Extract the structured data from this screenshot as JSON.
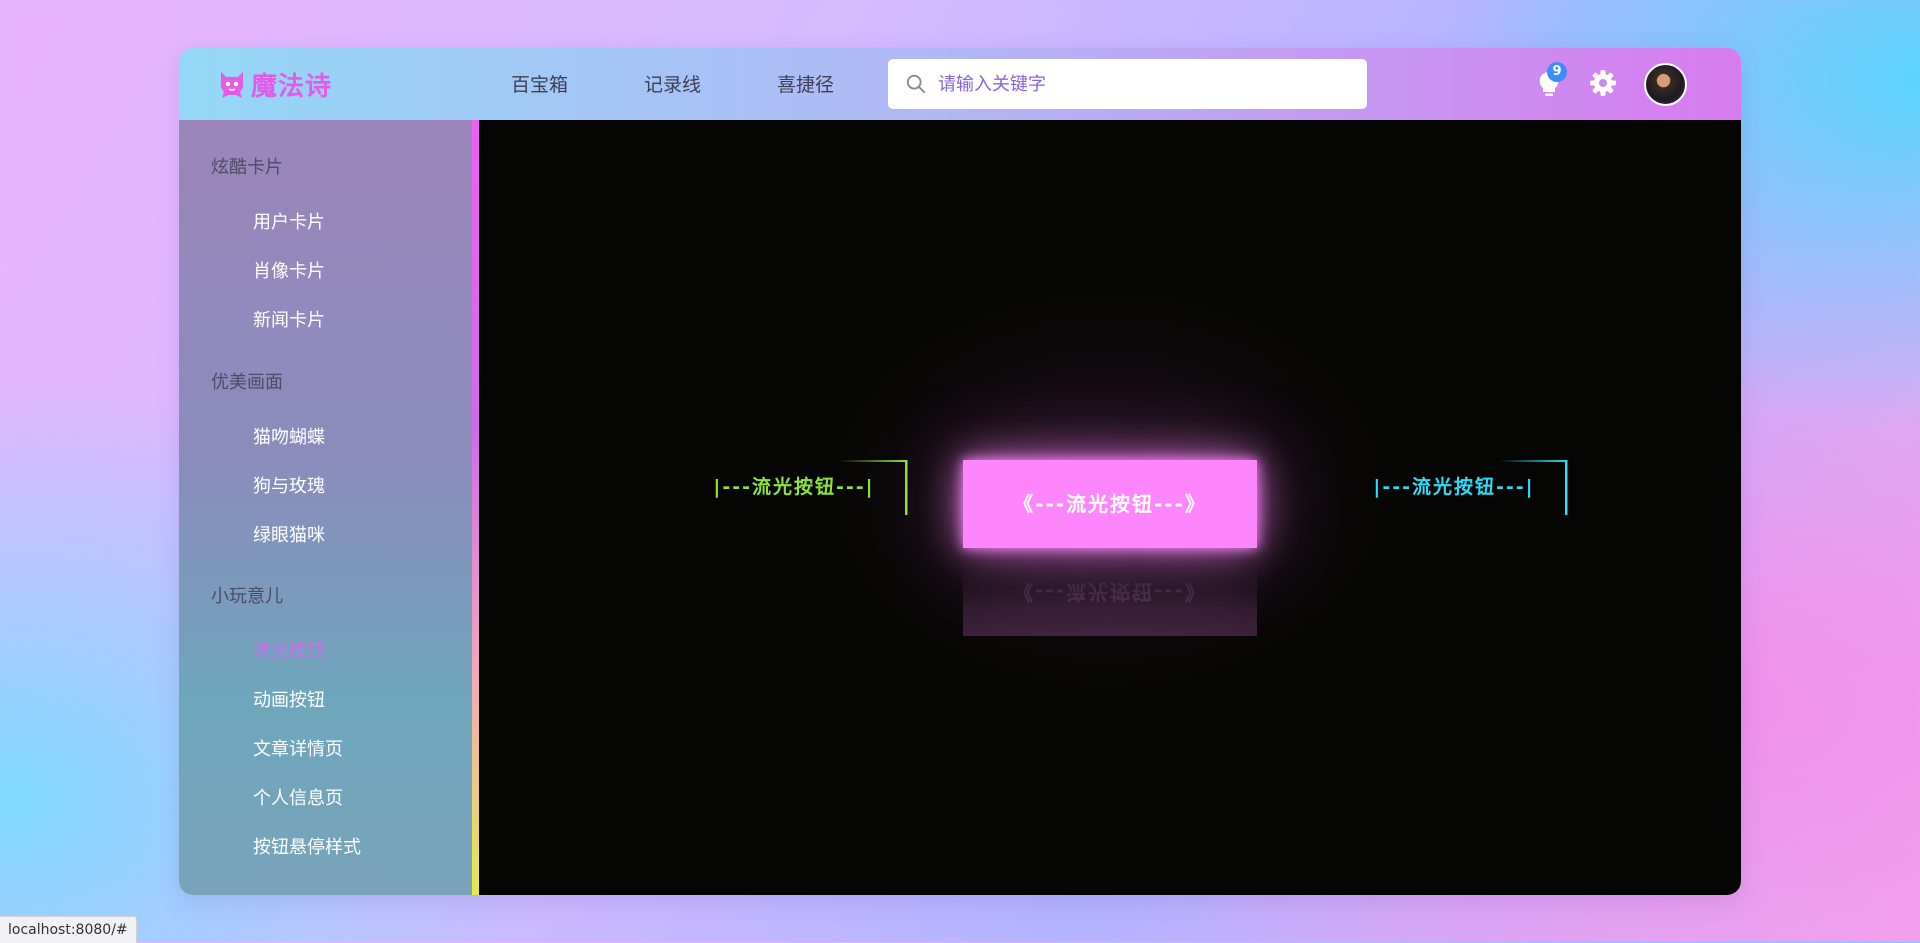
{
  "header": {
    "logo_text": "魔法诗",
    "nav": [
      "百宝箱",
      "记录线",
      "喜捷径"
    ],
    "search_placeholder": "请输入关键字",
    "notification_count": "9",
    "icons": [
      "cat-logo-icon",
      "search-icon",
      "lightbulb-icon",
      "gear-icon"
    ]
  },
  "sidebar": {
    "groups": [
      {
        "title": "炫酷卡片",
        "items": [
          "用户卡片",
          "肖像卡片",
          "新闻卡片"
        ]
      },
      {
        "title": "优美画面",
        "items": [
          "猫吻蝴蝶",
          "狗与玫瑰",
          "绿眼猫咪"
        ]
      },
      {
        "title": "小玩意儿",
        "items": [
          "流光按钮",
          "动画按钮",
          "文章详情页",
          "个人信息页",
          "按钮悬停样式"
        ]
      }
    ],
    "active_item": "流光按钮"
  },
  "stage": {
    "left_button": "|---流光按钮---|",
    "main_button": "《---流光按钮---》",
    "right_button": "|---流光按钮---|",
    "colors": {
      "left": "#8ee23a",
      "main": "#fd86fd",
      "right": "#2cdbf6",
      "background": "#050603"
    }
  },
  "status_bar": {
    "url": "localhost:8080/#"
  }
}
